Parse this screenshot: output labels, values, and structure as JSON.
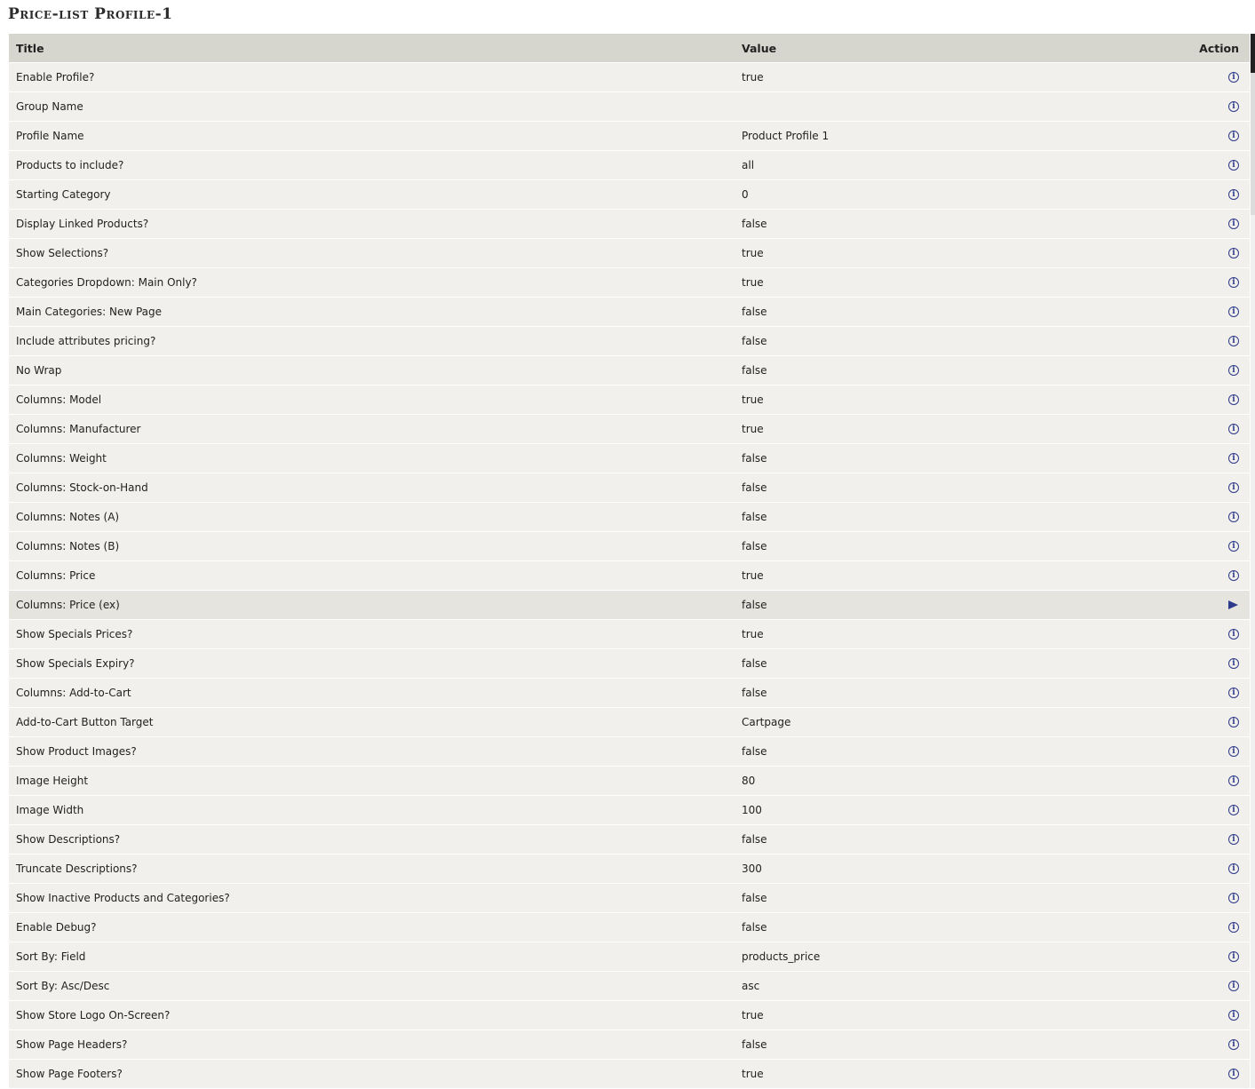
{
  "page": {
    "title": "Price-list Profile-1"
  },
  "table": {
    "headers": {
      "title": "Title",
      "value": "Value",
      "action": "Action"
    },
    "rows": [
      {
        "title": "Enable Profile?",
        "value": "true",
        "icon": "info-icon"
      },
      {
        "title": "Group Name",
        "value": "",
        "icon": "info-icon"
      },
      {
        "title": "Profile Name",
        "value": "Product Profile 1",
        "icon": "info-icon"
      },
      {
        "title": "Products to include?",
        "value": "all",
        "icon": "info-icon"
      },
      {
        "title": "Starting Category",
        "value": "0",
        "icon": "info-icon"
      },
      {
        "title": "Display Linked Products?",
        "value": "false",
        "icon": "info-icon"
      },
      {
        "title": "Show Selections?",
        "value": "true",
        "icon": "info-icon"
      },
      {
        "title": "Categories Dropdown: Main Only?",
        "value": "true",
        "icon": "info-icon"
      },
      {
        "title": "Main Categories: New Page",
        "value": "false",
        "icon": "info-icon"
      },
      {
        "title": "Include attributes pricing?",
        "value": "false",
        "icon": "info-icon"
      },
      {
        "title": "No Wrap",
        "value": "false",
        "icon": "info-icon"
      },
      {
        "title": "Columns: Model",
        "value": "true",
        "icon": "info-icon"
      },
      {
        "title": "Columns: Manufacturer",
        "value": "true",
        "icon": "info-icon"
      },
      {
        "title": "Columns: Weight",
        "value": "false",
        "icon": "info-icon"
      },
      {
        "title": "Columns: Stock-on-Hand",
        "value": "false",
        "icon": "info-icon"
      },
      {
        "title": "Columns: Notes (A)",
        "value": "false",
        "icon": "info-icon"
      },
      {
        "title": "Columns: Notes (B)",
        "value": "false",
        "icon": "info-icon"
      },
      {
        "title": "Columns: Price",
        "value": "true",
        "icon": "info-icon"
      },
      {
        "title": "Columns: Price (ex)",
        "value": "false",
        "icon": "arrow-right-icon",
        "selected": true
      },
      {
        "title": "Show Specials Prices?",
        "value": "true",
        "icon": "info-icon"
      },
      {
        "title": "Show Specials Expiry?",
        "value": "false",
        "icon": "info-icon"
      },
      {
        "title": "Columns: Add-to-Cart",
        "value": "false",
        "icon": "info-icon"
      },
      {
        "title": "Add-to-Cart Button Target",
        "value": "Cartpage",
        "icon": "info-icon"
      },
      {
        "title": "Show Product Images?",
        "value": "false",
        "icon": "info-icon"
      },
      {
        "title": "Image Height",
        "value": "80",
        "icon": "info-icon"
      },
      {
        "title": "Image Width",
        "value": "100",
        "icon": "info-icon"
      },
      {
        "title": "Show Descriptions?",
        "value": "false",
        "icon": "info-icon"
      },
      {
        "title": "Truncate Descriptions?",
        "value": "300",
        "icon": "info-icon"
      },
      {
        "title": "Show Inactive Products and Categories?",
        "value": "false",
        "icon": "info-icon"
      },
      {
        "title": "Enable Debug?",
        "value": "false",
        "icon": "info-icon"
      },
      {
        "title": "Sort By: Field",
        "value": "products_price",
        "icon": "info-icon"
      },
      {
        "title": "Sort By: Asc/Desc",
        "value": "asc",
        "icon": "info-icon"
      },
      {
        "title": "Show Store Logo On-Screen?",
        "value": "true",
        "icon": "info-icon"
      },
      {
        "title": "Show Page Headers?",
        "value": "false",
        "icon": "info-icon"
      },
      {
        "title": "Show Page Footers?",
        "value": "true",
        "icon": "info-icon"
      }
    ]
  },
  "icons": {
    "info_glyph": "i"
  },
  "colors": {
    "header_bg": "#d7d6ce",
    "row_bg": "#f1f0ec",
    "selected_bg": "#e5e4df",
    "icon": "#2e3a8c"
  }
}
